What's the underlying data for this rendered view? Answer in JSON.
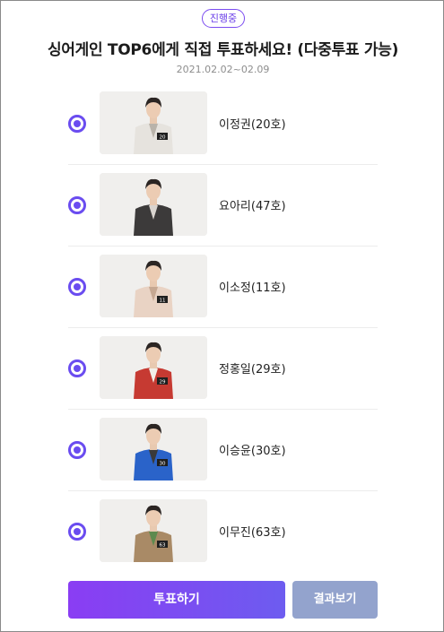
{
  "poll": {
    "status_badge": "진행중",
    "title": "싱어게인 TOP6에게 직접 투표하세요! (다중투표 가능)",
    "dates": "2021.02.02~02.09"
  },
  "candidates": [
    {
      "name": "이정권(20호)",
      "photo": "contestant-photo",
      "jacket": "#e6e3de",
      "accent": "#b9b3aa",
      "tag": "20"
    },
    {
      "name": "요아리(47호)",
      "photo": "contestant-photo",
      "jacket": "#3c3a3a",
      "accent": "#d9d4cf",
      "tag": ""
    },
    {
      "name": "이소정(11호)",
      "photo": "contestant-photo",
      "jacket": "#e9d3c4",
      "accent": "#c6a892",
      "tag": "11"
    },
    {
      "name": "정홍일(29호)",
      "photo": "contestant-photo",
      "jacket": "#c63a32",
      "accent": "#f2efe9",
      "tag": "29"
    },
    {
      "name": "이승윤(30호)",
      "photo": "contestant-photo",
      "jacket": "#2a63c9",
      "accent": "#3a3a3a",
      "tag": "30"
    },
    {
      "name": "이무진(63호)",
      "photo": "contestant-photo",
      "jacket": "#a98a66",
      "accent": "#5e8a4e",
      "tag": "63"
    }
  ],
  "buttons": {
    "vote_label": "투표하기",
    "result_label": "결과보기"
  },
  "colors": {
    "accent": "#6a4cf0",
    "vote_gradient_start": "#8a3df3",
    "vote_gradient_end": "#6d5cf0",
    "result_button": "#93a3cd"
  }
}
